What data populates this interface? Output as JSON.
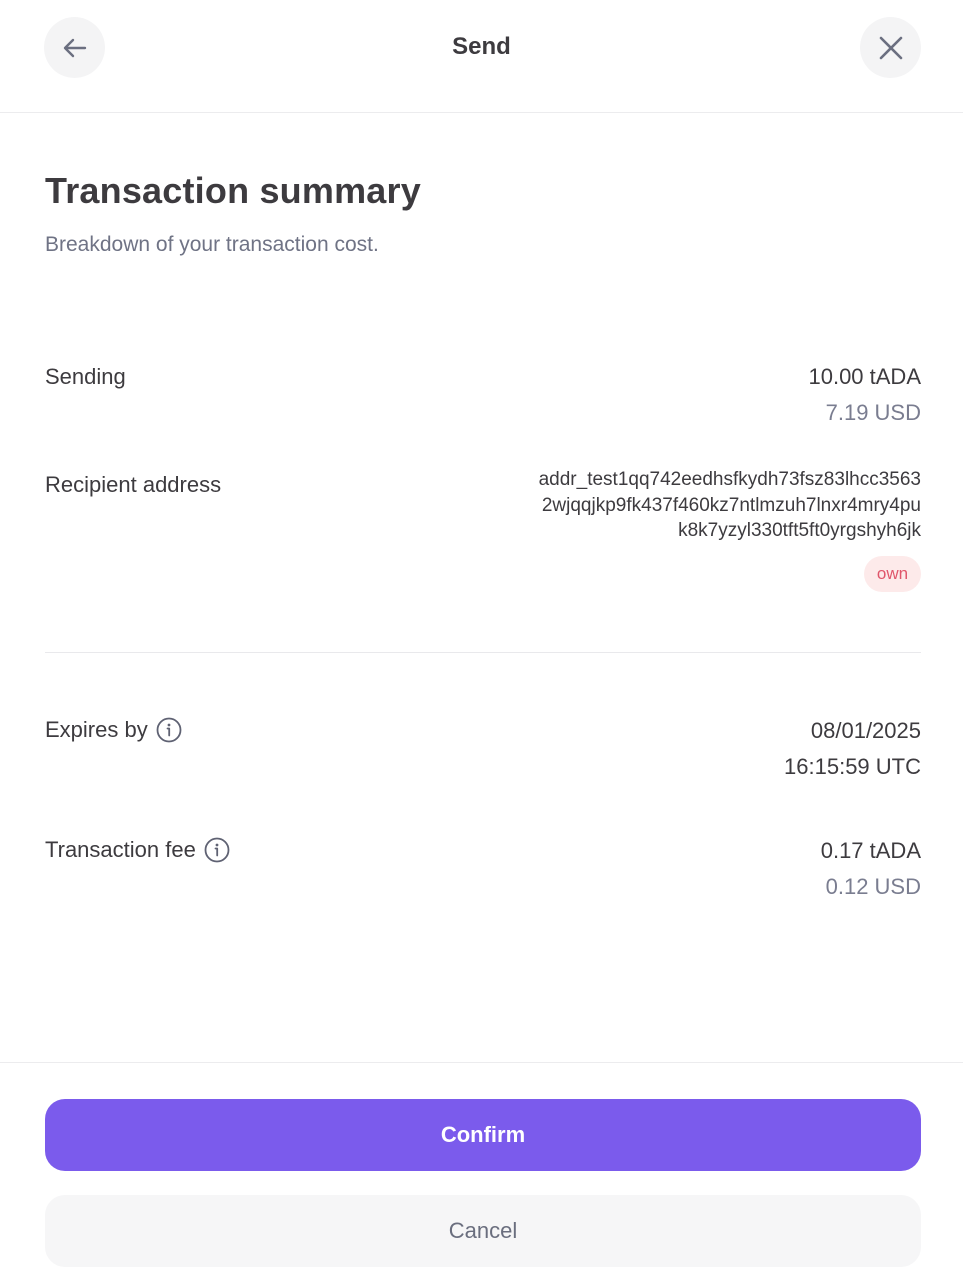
{
  "header": {
    "title": "Send",
    "back_icon": "arrow-left-icon",
    "close_icon": "close-icon"
  },
  "summary": {
    "title": "Transaction summary",
    "subtitle": "Breakdown of your transaction cost."
  },
  "sending": {
    "label": "Sending",
    "amount": "10.00 tADA",
    "fiat": "7.19 USD"
  },
  "recipient": {
    "label": "Recipient address",
    "address_lines": [
      "addr_test1qq742eedhsfkydh73fsz83lhcc3563",
      "2wjqqjkp9fk437f460kz7ntlmzuh7lnxr4mry4pu",
      "k8k7yzyl330tft5ft0yrgshyh6jk"
    ],
    "badge": "own"
  },
  "expires": {
    "label": "Expires by",
    "date": "08/01/2025",
    "time": "16:15:59 UTC",
    "icon": "info-icon"
  },
  "fee": {
    "label": "Transaction fee",
    "amount": "0.17 tADA",
    "fiat": "0.12 USD",
    "icon": "info-icon"
  },
  "actions": {
    "confirm_label": "Confirm",
    "cancel_label": "Cancel"
  },
  "colors": {
    "accent": "#7b5bec",
    "badge_bg": "#fdeaea",
    "badge_text": "#e0566b",
    "muted_text": "#7a7d90"
  }
}
